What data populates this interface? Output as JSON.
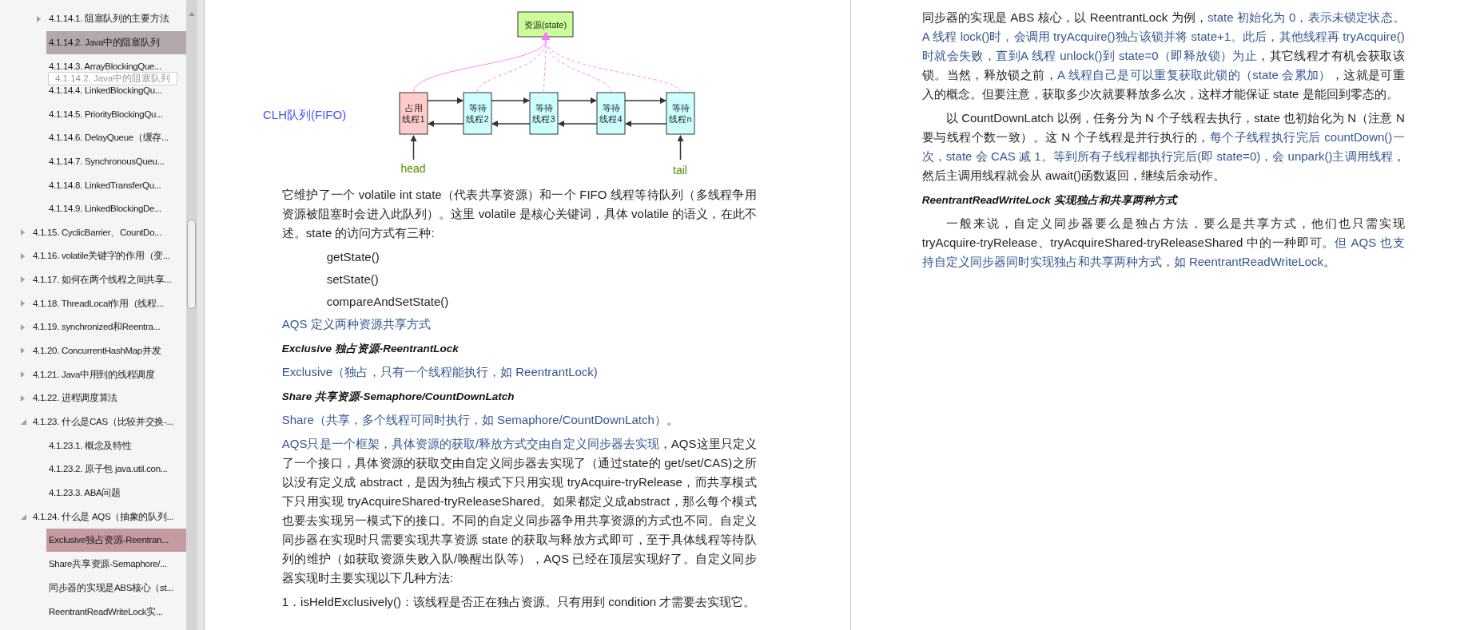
{
  "outline": {
    "items": [
      {
        "children": [
          {
            "label": "4.1.14.1. 阻塞队列的主要方法",
            "expanded": false,
            "selected": false,
            "hovered": false
          },
          {
            "label": "4.1.14.2. Java中的阻塞队列",
            "selected": false,
            "hovered": true
          },
          {
            "label": "4.1.14.3. ArrayBlockingQue...",
            "selected": false,
            "hovered": false
          },
          {
            "label": "4.1.14.4. LinkedBlockingQu...",
            "selected": false,
            "hovered": false
          },
          {
            "label": "4.1.14.5. PriorityBlockingQu...",
            "selected": false,
            "hovered": false
          },
          {
            "label": "4.1.14.6. DelayQueue（缓存...",
            "selected": false,
            "hovered": false
          },
          {
            "label": "4.1.14.7. SynchronousQueu...",
            "selected": false,
            "hovered": false
          },
          {
            "label": "4.1.14.8. LinkedTransferQu...",
            "selected": false,
            "hovered": false
          },
          {
            "label": "4.1.14.9. LinkedBlockingDe...",
            "selected": false,
            "hovered": false
          }
        ]
      },
      {
        "label": "4.1.15. CyclicBarrier、CountDo...",
        "expanded": false,
        "selected": false,
        "hovered": false
      },
      {
        "label": "4.1.16. volatile关键字的作用（变...",
        "expanded": false,
        "selected": false,
        "hovered": false
      },
      {
        "label": "4.1.17. 如何在两个线程之间共享...",
        "expanded": false,
        "selected": false,
        "hovered": false
      },
      {
        "label": "4.1.18. ThreadLocal作用（线程...",
        "expanded": false,
        "selected": false,
        "hovered": false
      },
      {
        "label": "4.1.19. synchronized和Reentra...",
        "expanded": false,
        "selected": false,
        "hovered": false
      },
      {
        "label": "4.1.20. ConcurrentHashMap并发",
        "expanded": false,
        "selected": false,
        "hovered": false
      },
      {
        "label": "4.1.21. Java中用到的线程调度",
        "expanded": false,
        "selected": false,
        "hovered": false
      },
      {
        "label": "4.1.22. 进程调度算法",
        "expanded": false,
        "selected": false,
        "hovered": false
      },
      {
        "label": "4.1.23. 什么是CAS（比较并交换-...",
        "expanded": true,
        "selected": false,
        "hovered": false,
        "children": [
          {
            "label": "4.1.23.1. 概念及特性",
            "selected": false,
            "hovered": false
          },
          {
            "label": "4.1.23.2. 原子包 java.util.con...",
            "selected": false,
            "hovered": false
          },
          {
            "label": "4.1.23.3. ABA问题",
            "selected": false,
            "hovered": false
          }
        ]
      },
      {
        "label": "4.1.24. 什么是 AQS（抽象的队列...",
        "expanded": true,
        "selected": false,
        "hovered": false,
        "children": [
          {
            "label": "Exclusive独占资源-Reentran...",
            "selected": true,
            "hovered": false
          },
          {
            "label": "Share共享资源-Semaphore/...",
            "selected": false,
            "hovered": false
          },
          {
            "label": "同步器的实现是ABS核心（st...",
            "selected": false,
            "hovered": false
          },
          {
            "label": "ReentrantReadWriteLock实...",
            "selected": false,
            "hovered": false
          }
        ]
      }
    ],
    "tooltip": "4.1.14.2. Java中的阻塞队列"
  },
  "pages": [
    {
      "blocks": [
        {
          "kind": "figure",
          "resource": "资源(state)",
          "queue_label": "CLH队列(FIFO)",
          "head": "head",
          "tail": "tail",
          "nodes": [
            {
              "kind": "holder",
              "lines": [
                "占用",
                "线程1"
              ]
            },
            {
              "kind": "waiter",
              "lines": [
                "等待",
                "线程2"
              ]
            },
            {
              "kind": "waiter",
              "lines": [
                "等待",
                "线程3"
              ]
            },
            {
              "kind": "waiter",
              "lines": [
                "等待",
                "线程4"
              ]
            },
            {
              "kind": "waiter",
              "lines": [
                "等待",
                "线程n"
              ]
            }
          ]
        },
        {
          "kind": "paragraph",
          "runs": [
            {
              "text": "它维护了一个 volatile int state（代表共享资源）和一个 FIFO 线程等待队列（多线程争用资源被阻塞时会进入此队列）。这里 volatile 是核心关键词，具体 volatile 的语义，在此不述。state 的访问方式有三种:",
              "highlight": false
            }
          ]
        },
        {
          "kind": "method",
          "text": "getState()"
        },
        {
          "kind": "method",
          "text": "setState()"
        },
        {
          "kind": "method",
          "text": "compareAndSetState()"
        },
        {
          "kind": "paragraph",
          "runs": [
            {
              "text": "AQS 定义两种资源共享方式",
              "highlight": true
            }
          ]
        },
        {
          "kind": "heading",
          "text": "Exclusive 独占资源-ReentrantLock"
        },
        {
          "kind": "paragraph",
          "runs": [
            {
              "text": "Exclusive（独占，只有一个线程能执行，如 ReentrantLock)",
              "highlight": true
            }
          ]
        },
        {
          "kind": "heading",
          "text": "Share 共享资源-Semaphore/CountDownLatch"
        },
        {
          "kind": "paragraph",
          "runs": [
            {
              "text": "Share（共享，多个线程可同时执行，如 Semaphore/CountDownLatch）",
              "highlight": true
            },
            {
              "text": "。",
              "highlight": false
            }
          ]
        },
        {
          "kind": "paragraph",
          "runs": [
            {
              "text": "AQS只是一个框架，具体资源的获取/释放方式交由自定义同步器去实现",
              "highlight": true
            },
            {
              "text": "，AQS这里只定义了一个接口，具体资源的获取交由自定义同步器去实现了（通过state的 get/set/CAS)之所以没有定义成 abstract，是因为独占模式下只用实现 tryAcquire-tryRelease，而共享模式下只用实现 tryAcquireShared-tryReleaseShared。如果都定义成abstract，那么每个模式也要去实现另一模式下的接口。不同的自定义同步器争用共享资源的方式也不同。自定义同步器在实现时只需要实现共享资源 state 的获取与释放方式即可，至于具体线程等待队列的维护（如获取资源失败入队/唤醒出队等），AQS 已经在顶层实现好了。自定义同步器实现时主要实现以下几种方法:",
              "highlight": false
            }
          ]
        },
        {
          "kind": "paragraph",
          "runs": [
            {
              "text": "1．isHeldExclusively()：该线程是否正在独占资源。只有用到 condition 才需要去实现它。",
              "highlight": false
            }
          ]
        }
      ]
    },
    {
      "blocks": [
        {
          "kind": "paragraph",
          "runs": [
            {
              "text": "同步器的实现是 ABS 核心，以 ReentrantLock 为例，",
              "highlight": false
            },
            {
              "text": "state 初始化为 0，表示未锁定状态。A 线程 lock()时，会调用 tryAcquire()独占该锁并将 state+1。此后，其他线程再 tryAcquire()时就会失败，直到A 线程 unlock()到 state=0（即释放锁）为止",
              "highlight": true
            },
            {
              "text": "，其它线程才有机会获取该锁。当然，释放锁之前，",
              "highlight": false
            },
            {
              "text": "A 线程自己是可以重复获取此锁的（state 会累加）",
              "highlight": true
            },
            {
              "text": "，这就是可重入的概念。但要注意，获取多少次就要释放多么次，这样才能保证 state 是能回到零态的。",
              "highlight": false
            }
          ]
        },
        {
          "kind": "indented_paragraph",
          "runs": [
            {
              "text": "以 CountDownLatch 以例，任务分为 N 个子线程去执行，state 也初始化为 N（注意 N 要与线程个数一致）。这 N 个子线程是并行执行的，",
              "highlight": false
            },
            {
              "text": "每个子线程执行完后 countDown()一次，state 会 CAS 减 1。等到所有子线程都执行完后(即 state=0)，会 unpark()主调用线程",
              "highlight": true
            },
            {
              "text": "，然后主调用线程就会从 await()函数返回，继续后余动作。",
              "highlight": false
            }
          ]
        },
        {
          "kind": "heading",
          "text": "ReentrantReadWriteLock 实现独占和共享两种方式"
        },
        {
          "kind": "indented_paragraph",
          "runs": [
            {
              "text": "一般来说，自定义同步器要么是独占方法，要么是共享方式，他们也只需实现 tryAcquire-tryRelease、tryAcquireShared-tryReleaseShared 中的一种即可。",
              "highlight": false
            },
            {
              "text": "但 AQS 也支持自定义同步器同时实现独占和共享两种方式，如 ReentrantReadWriteLock",
              "highlight": true
            },
            {
              "text": "。",
              "highlight": false
            }
          ]
        }
      ]
    }
  ]
}
